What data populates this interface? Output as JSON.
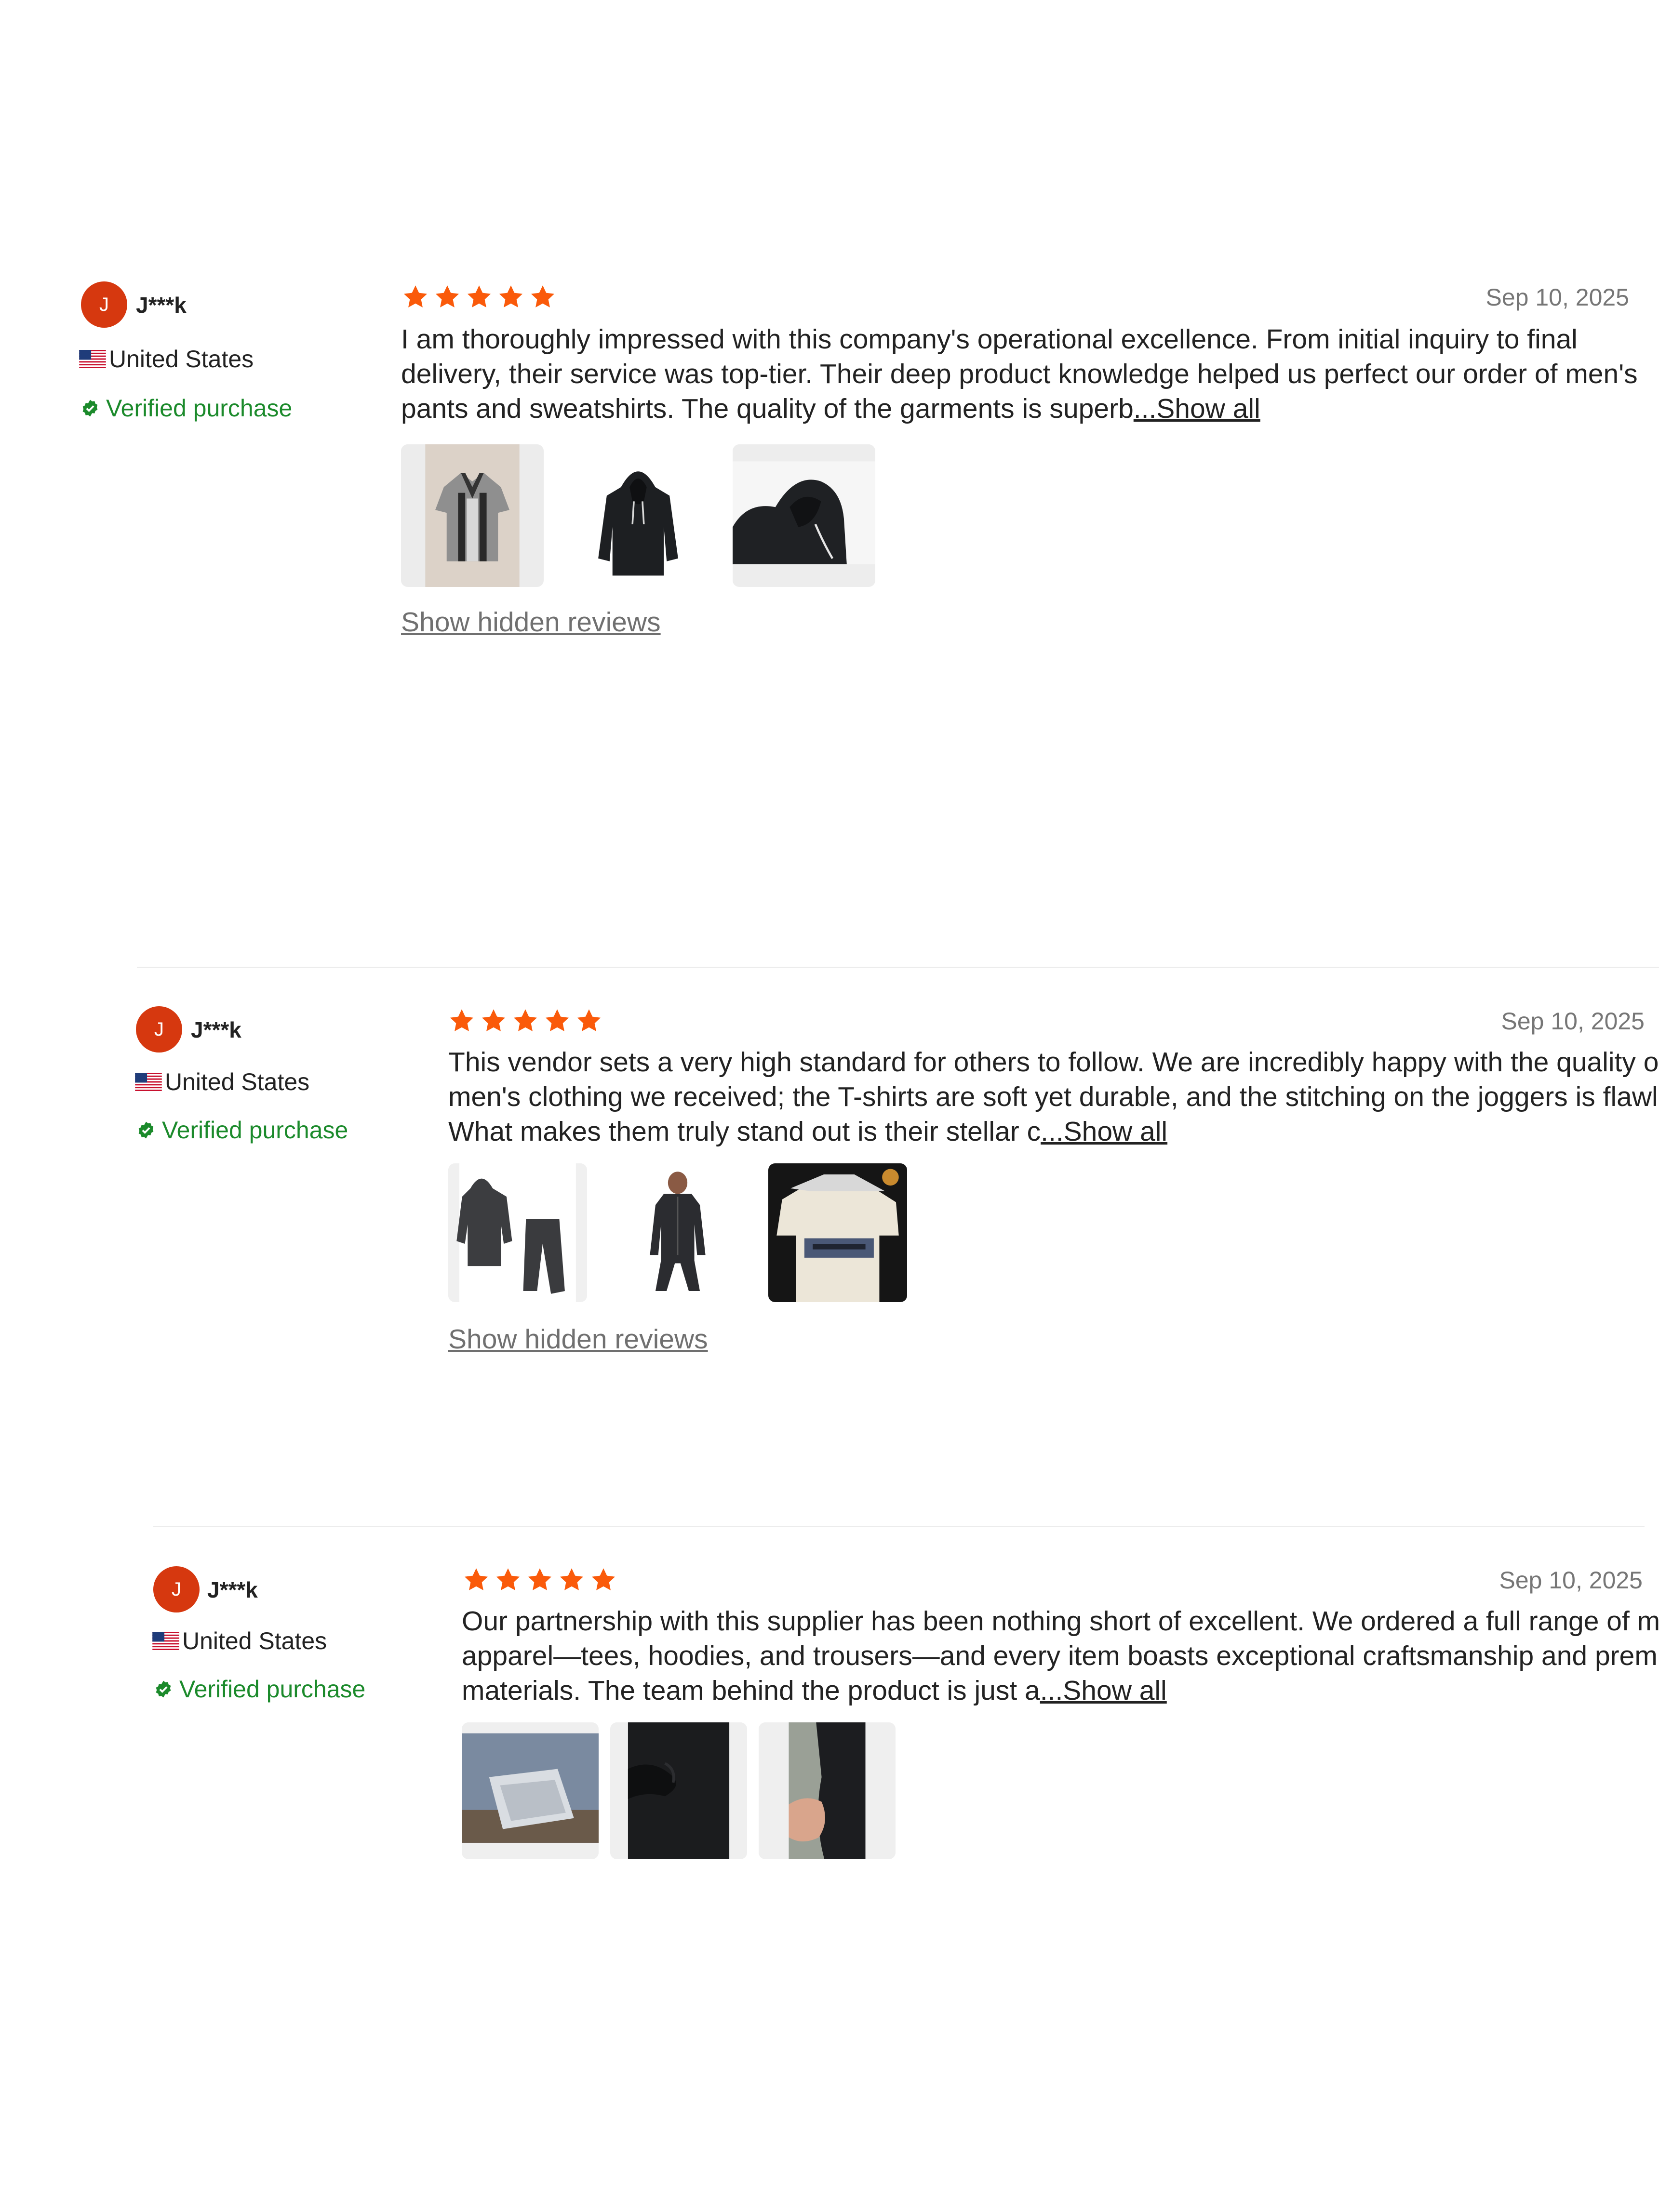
{
  "colors": {
    "accent_star": "#fa5a0a",
    "avatar_bg": "#d6380f",
    "verified_green": "#1b8a2b",
    "date_gray": "#767676",
    "link_gray": "#707070"
  },
  "icons": {
    "star": "star-icon",
    "flag": "us-flag-icon",
    "verified": "verified-check-icon"
  },
  "reviews": [
    {
      "avatar_initial": "J",
      "name": "J***k",
      "country": "United States",
      "verified_label": "Verified purchase",
      "rating": 5,
      "date": "Sep 10, 2025",
      "text": "I am thoroughly impressed with this company's operational excellence. From initial inquiry to final delivery, their service was top-tier. Their deep product knowledge helped us perfect our order of men's pants and sweatshirts. The quality of the garments is superb",
      "show_all_label": "...Show all",
      "photos": [
        "polo-shirt-photo",
        "black-hoodie-photo",
        "hoodie-closeup-photo"
      ],
      "show_hidden_label": "Show hidden reviews"
    },
    {
      "avatar_initial": "J",
      "name": "J***k",
      "country": "United States",
      "verified_label": "Verified purchase",
      "rating": 5,
      "date": "Sep 10, 2025",
      "text": "This vendor sets a very high standard for others to follow. We are incredibly happy with the quality of the men's clothing we received; the T-shirts are soft yet durable, and the stitching on the joggers is flawless. What makes them truly stand out is their stellar c",
      "show_all_label": "...Show all",
      "photos": [
        "tracksuit-photo",
        "zip-jumpsuit-photo",
        "graphic-tee-photo"
      ],
      "show_hidden_label": "Show hidden reviews"
    },
    {
      "avatar_initial": "J",
      "name": "J***k",
      "country": "United States",
      "verified_label": "Verified purchase",
      "rating": 5,
      "date": "Sep 10, 2025",
      "text": "Our partnership with this supplier has been nothing short of excellent. We ordered a full range of men's apparel—tees, hoodies, and trousers—and every item boasts exceptional craftsmanship and premium materials. The team behind the product is just a",
      "show_all_label": "...Show all",
      "photos": [
        "packaged-garments-photo",
        "black-fabric-photo",
        "fabric-in-hand-photo"
      ]
    }
  ]
}
